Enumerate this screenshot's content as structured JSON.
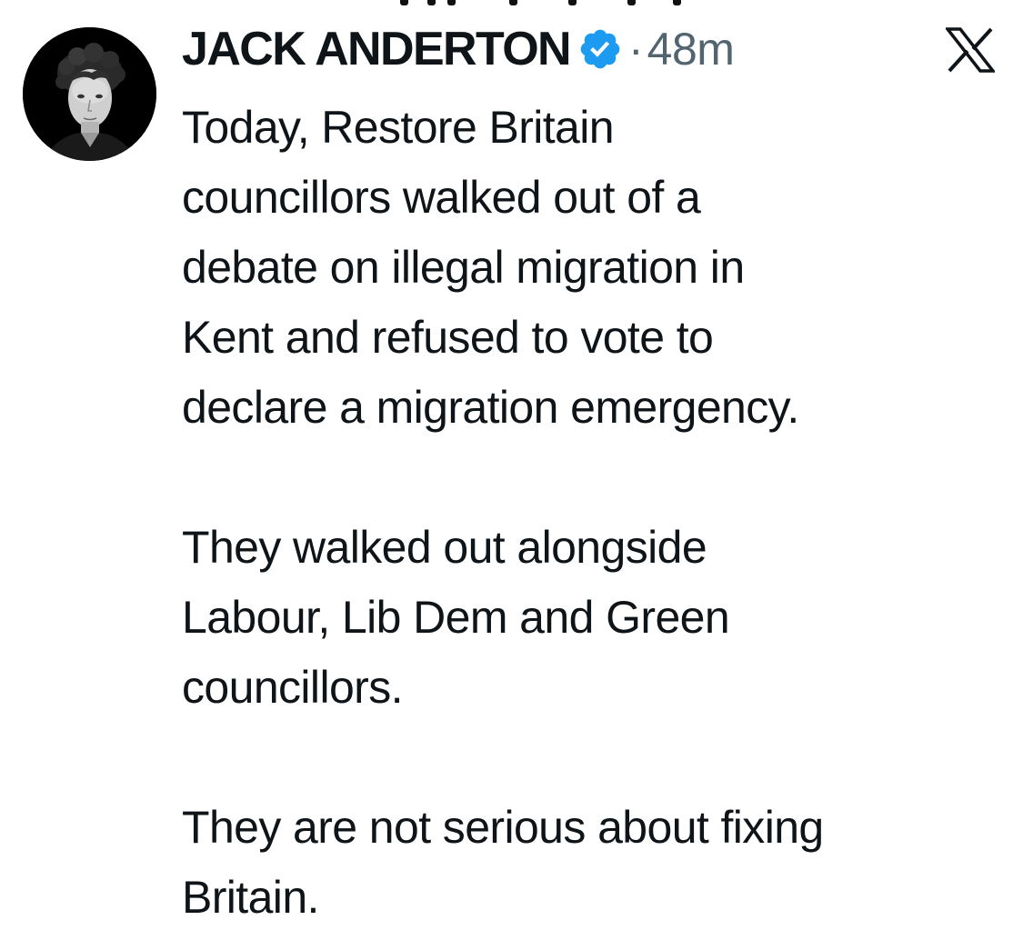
{
  "tweet": {
    "author": {
      "display_name": "JACK ANDERTON",
      "verified": true,
      "avatar": "profile-photo-monochrome"
    },
    "separator": "·",
    "timestamp": "48m",
    "platform_icon": "x-logo-icon",
    "paragraphs": [
      "Today, Restore Britain\ncouncillors walked out of a\ndebate on illegal migration in\nKent and refused to vote to\ndeclare a migration emergency.",
      "They walked out alongside\nLabour, Lib Dem and Green\ncouncillors.",
      "They are not serious about fixing\nBritain."
    ]
  },
  "colors": {
    "text": "#0f1419",
    "secondary": "#536471",
    "verified_blue": "#1d9bf0",
    "background": "#ffffff"
  }
}
